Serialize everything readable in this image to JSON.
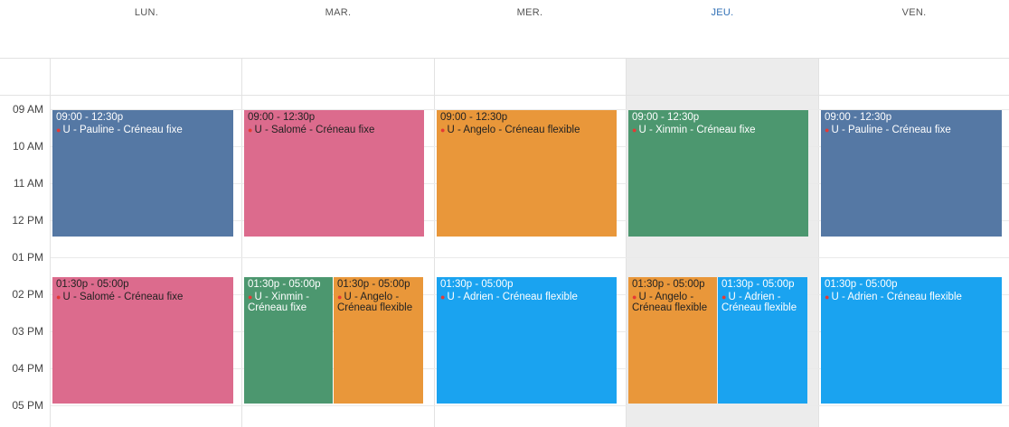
{
  "days": [
    {
      "label": "LUN.",
      "today": false
    },
    {
      "label": "MAR.",
      "today": false
    },
    {
      "label": "MER.",
      "today": false
    },
    {
      "label": "JEU.",
      "today": true
    },
    {
      "label": "VEN.",
      "today": false
    }
  ],
  "hours": [
    "09 AM",
    "10 AM",
    "11 AM",
    "12 PM",
    "01 PM",
    "02 PM",
    "03 PM",
    "04 PM",
    "05 PM"
  ],
  "events": {
    "lun_am": {
      "time": "09:00 - 12:30p",
      "title": "U - Pauline - Créneau fixe"
    },
    "mar_am": {
      "time": "09:00 - 12:30p",
      "title": "U - Salomé - Créneau fixe"
    },
    "mer_am": {
      "time": "09:00 - 12:30p",
      "title": "U - Angelo - Créneau flexible"
    },
    "jeu_am": {
      "time": "09:00 - 12:30p",
      "title": "U - Xinmin - Créneau fixe"
    },
    "ven_am": {
      "time": "09:00 - 12:30p",
      "title": "U - Pauline - Créneau fixe"
    },
    "lun_pm": {
      "time": "01:30p - 05:00p",
      "title": "U - Salomé - Créneau fixe"
    },
    "mar_pm_a": {
      "time": "01:30p - 05:00p",
      "title": "U - Xinmin - Créneau fixe"
    },
    "mar_pm_b": {
      "time": "01:30p - 05:00p",
      "title": "U - Angelo - Créneau flexible"
    },
    "mer_pm": {
      "time": "01:30p - 05:00p",
      "title": "U - Adrien - Créneau flexible"
    },
    "jeu_pm_a": {
      "time": "01:30p - 05:00p",
      "title": "U - Angelo - Créneau flexible"
    },
    "jeu_pm_b": {
      "time": "01:30p - 05:00p",
      "title": "U - Adrien - Créneau flexible"
    },
    "ven_pm": {
      "time": "01:30p - 05:00p",
      "title": "U - Adrien - Créneau flexible"
    }
  },
  "colors": {
    "blue": "#5578a4",
    "pink": "#dc6b8d",
    "orange": "#e9973a",
    "green": "#4c976f",
    "cyan": "#1aa3f0",
    "today_bg": "#ececec"
  }
}
